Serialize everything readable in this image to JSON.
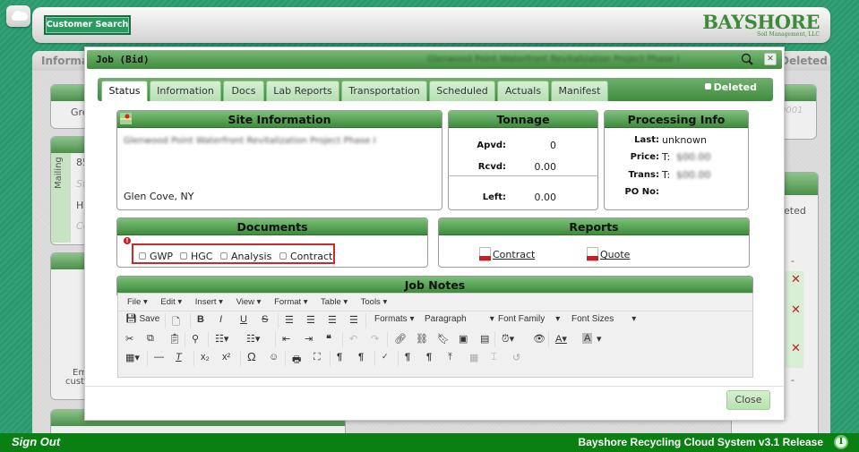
{
  "header": {
    "customer_search_label": "Customer Search",
    "logo_text": "BAYSHORE",
    "logo_subtext": "Soil Management, LLC"
  },
  "background": {
    "left_tab": "Information",
    "right_tab": "Deleted",
    "left_texts": [
      "Gre",
      "85",
      "St",
      "Ha",
      "Co",
      "Em",
      "cust"
    ],
    "mailing_label": "Mailing",
    "right_texts": [
      "0001",
      "eted",
      "-",
      "-"
    ]
  },
  "modal": {
    "title": "Job (Bid)",
    "subtitle": "Glenwood Point Waterfront Revitalization Project Phase I",
    "tabs": [
      "Status",
      "Information",
      "Docs",
      "Lab Reports",
      "Transportation",
      "Scheduled",
      "Actuals",
      "Manifest"
    ],
    "active_tab": "Status",
    "deleted_label": "Deleted",
    "site_info": {
      "title": "Site Information",
      "project_name": "Glenwood Point Waterfront Revitalization Project Phase I",
      "location": "Glen Cove, NY"
    },
    "tonnage": {
      "title": "Tonnage",
      "rows": [
        {
          "label": "Apvd:",
          "value": "0"
        },
        {
          "label": "Rcvd:",
          "value": "0.00"
        },
        {
          "label": "Left:",
          "value": "0.00"
        }
      ]
    },
    "processing": {
      "title": "Processing Info",
      "rows": [
        {
          "label": "Last:",
          "value": "unknown",
          "blurred": ""
        },
        {
          "label": "Price:",
          "value": "T:",
          "blurred": "$00.00"
        },
        {
          "label": "Trans:",
          "value": "T:",
          "blurred": "$00.00"
        },
        {
          "label": "PO No:",
          "value": "",
          "blurred": ""
        }
      ]
    },
    "documents": {
      "title": "Documents",
      "checkboxes": [
        "GWP",
        "HGC",
        "Analysis",
        "Contract"
      ]
    },
    "reports": {
      "title": "Reports",
      "links": [
        "Contract",
        "Quote"
      ]
    },
    "job_notes": {
      "title": "Job Notes",
      "menu": [
        "File ▾",
        "Edit ▾",
        "Insert ▾",
        "View ▾",
        "Format ▾",
        "Table ▾",
        "Tools ▾"
      ],
      "save_label": "Save",
      "formats_label": "Formats ▾",
      "paragraph_label": "Paragraph",
      "font_family_label": "Font Family",
      "font_sizes_label": "Font Sizes"
    },
    "close_label": "Close"
  },
  "footer": {
    "sign_out": "Sign Out",
    "release": "Bayshore Recycling Cloud System v3.1 Release",
    "info_glyph": "I"
  }
}
